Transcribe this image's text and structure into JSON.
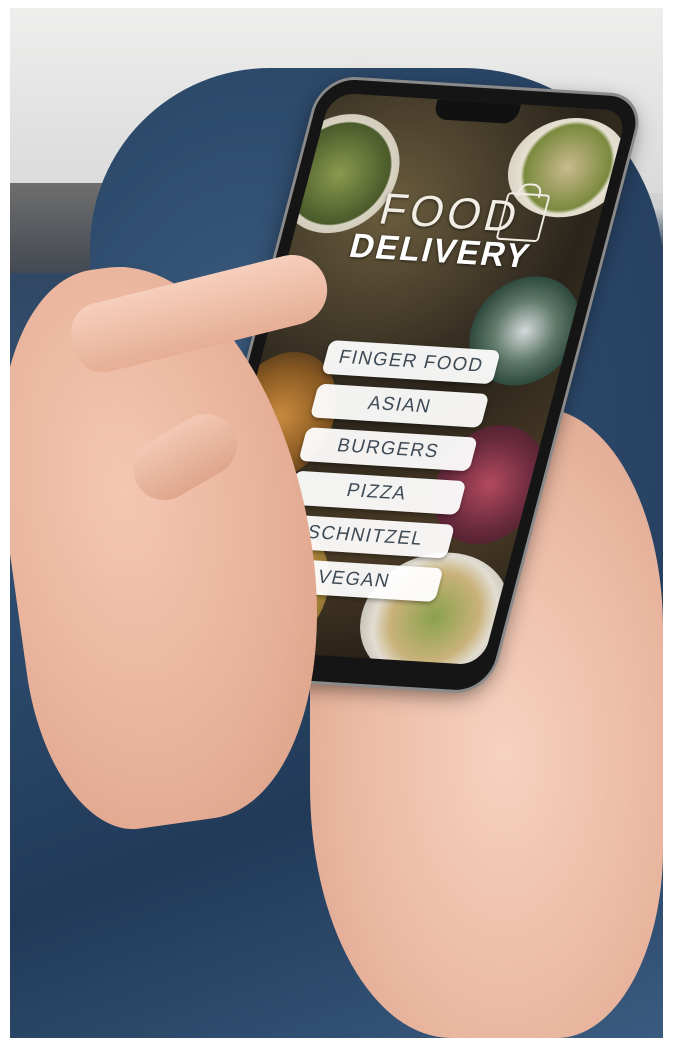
{
  "app": {
    "brand_top": "FOOD",
    "brand_bottom": "DELIVERY"
  },
  "menu": {
    "items": [
      {
        "label": "FINGER FOOD"
      },
      {
        "label": "ASIAN"
      },
      {
        "label": "BURGERS"
      },
      {
        "label": "PIZZA"
      },
      {
        "label": "SCHNITZEL"
      },
      {
        "label": "VEGAN"
      }
    ]
  },
  "colors": {
    "menu_button_bg": "#ffffff",
    "menu_button_text": "#3e4a55",
    "brand_text": "#ffffff",
    "jeans": "#2d4a6b",
    "skin": "#e9b39b"
  },
  "icons": {
    "brand_icon": "shopping-bag-icon"
  }
}
